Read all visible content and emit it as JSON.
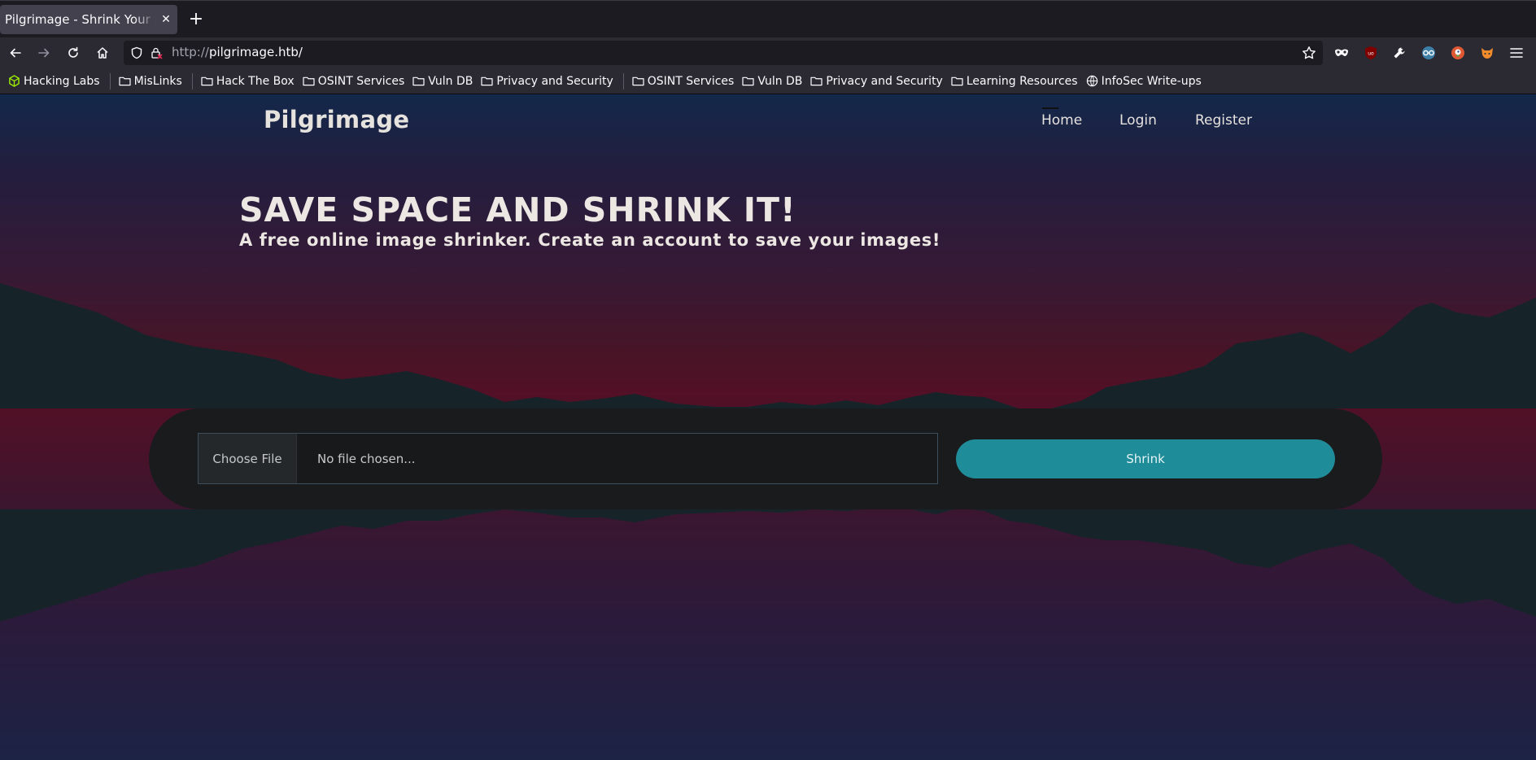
{
  "browser": {
    "tab": {
      "title": "Pilgrimage - Shrink Your Images",
      "close_icon": "close-icon"
    },
    "new_tab_icon": "plus-icon",
    "url": {
      "protocol": "http://",
      "host": "pilgrimage.htb/"
    },
    "toolbar_icons": [
      "back-arrow-icon",
      "forward-arrow-icon",
      "reload-icon",
      "home-icon",
      "shield-icon",
      "lock-icon",
      "star-icon",
      "mask-icon",
      "ublock-icon",
      "wrench-icon",
      "glasses-icon",
      "duckduckgo-icon",
      "foxyproxy-icon",
      "menu-icon"
    ],
    "bookmarks": [
      {
        "label": "Hacking Labs",
        "icon": "cube-icon"
      },
      {
        "label": "MisLinks",
        "icon": "folder-icon"
      },
      {
        "label": "Hack The Box",
        "icon": "folder-icon"
      },
      {
        "label": "OSINT Services",
        "icon": "folder-icon"
      },
      {
        "label": "Vuln DB",
        "icon": "folder-icon"
      },
      {
        "label": "Privacy and Security",
        "icon": "folder-icon"
      },
      {
        "label": "OSINT Services",
        "icon": "folder-icon"
      },
      {
        "label": "Vuln DB",
        "icon": "folder-icon"
      },
      {
        "label": "Privacy and Security",
        "icon": "folder-icon"
      },
      {
        "label": "Learning Resources",
        "icon": "folder-icon"
      },
      {
        "label": "InfoSec Write-ups",
        "icon": "globe-icon"
      }
    ]
  },
  "site": {
    "logo": "Pilgrimage",
    "nav": {
      "home": "Home",
      "login": "Login",
      "register": "Register"
    },
    "hero": {
      "title": "SAVE SPACE AND SHRINK IT!",
      "subtitle": "A free online image shrinker. Create an account to save your images!"
    },
    "upload": {
      "choose_label": "Choose File",
      "file_placeholder": "No file chosen...",
      "submit_label": "Shrink"
    },
    "colors": {
      "accent": "#1e8c99",
      "panel": "#1a1b1d"
    }
  }
}
